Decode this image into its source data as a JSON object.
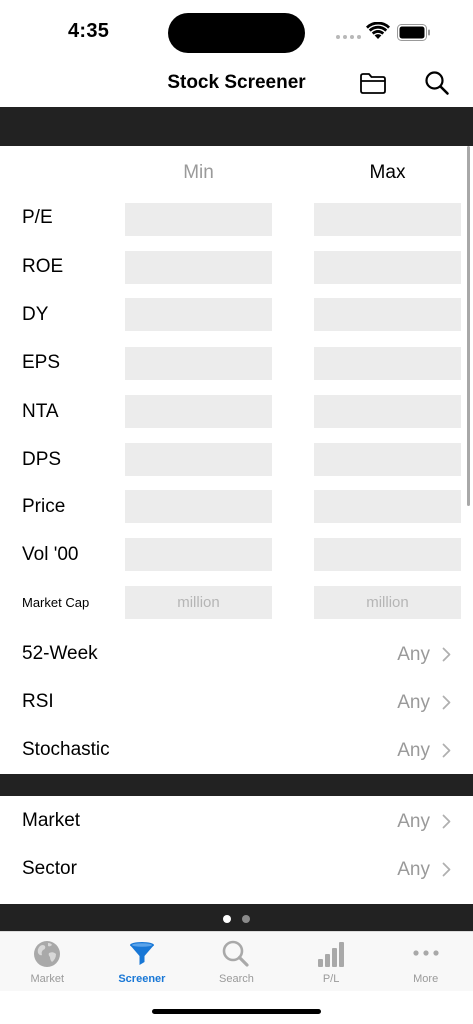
{
  "status": {
    "time": "4:35"
  },
  "nav": {
    "title": "Stock Screener"
  },
  "columns": {
    "min": "Min",
    "max": "Max"
  },
  "ranges": [
    {
      "label": "P/E",
      "min_value": "",
      "max_value": ""
    },
    {
      "label": "ROE",
      "min_value": "",
      "max_value": ""
    },
    {
      "label": "DY",
      "min_value": "",
      "max_value": ""
    },
    {
      "label": "EPS",
      "min_value": "",
      "max_value": ""
    },
    {
      "label": "NTA",
      "min_value": "",
      "max_value": ""
    },
    {
      "label": "DPS",
      "min_value": "",
      "max_value": ""
    },
    {
      "label": "Price",
      "min_value": "",
      "max_value": ""
    },
    {
      "label": "Vol '00",
      "min_value": "",
      "max_value": ""
    },
    {
      "label": "Market Cap",
      "min_placeholder": "million",
      "max_placeholder": "million"
    }
  ],
  "technical": [
    {
      "label": "52-Week",
      "value": "Any"
    },
    {
      "label": "RSI",
      "value": "Any"
    },
    {
      "label": "Stochastic",
      "value": "Any"
    }
  ],
  "filters": [
    {
      "label": "Market",
      "value": "Any"
    },
    {
      "label": "Sector",
      "value": "Any"
    }
  ],
  "page_control": {
    "pages": 2,
    "current": 1
  },
  "tabs": [
    {
      "label": "Market",
      "icon": "globe-icon"
    },
    {
      "label": "Screener",
      "icon": "funnel-icon",
      "active": true
    },
    {
      "label": "Search",
      "icon": "search-icon"
    },
    {
      "label": "P/L",
      "icon": "bar-chart-icon"
    },
    {
      "label": "More",
      "icon": "more-dots-icon"
    }
  ],
  "colors": {
    "accent": "#1877d6",
    "band": "#222222",
    "field": "#ececec"
  }
}
